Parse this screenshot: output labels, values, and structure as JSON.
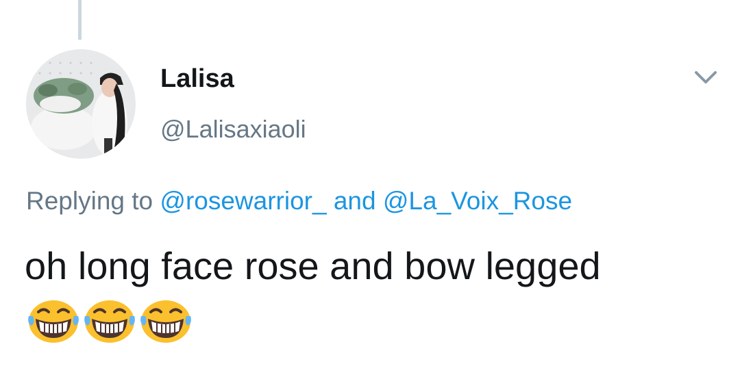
{
  "tweet": {
    "author": {
      "display_name": "Lalisa",
      "handle": "@Lalisaxiaoli"
    },
    "reply": {
      "prefix": "Replying to",
      "mentions": [
        "@rosewarrior_",
        "@La_Voix_Rose"
      ],
      "conjunction": "and"
    },
    "text": "oh long face rose and bow legged",
    "emojis": [
      "tears-of-joy-face",
      "tears-of-joy-face",
      "tears-of-joy-face"
    ]
  },
  "colors": {
    "name": "#14171a",
    "secondary": "#657786",
    "link": "#1b95e0",
    "thread_line": "#ccd6dd",
    "emoji_face": "#fbc02d"
  }
}
